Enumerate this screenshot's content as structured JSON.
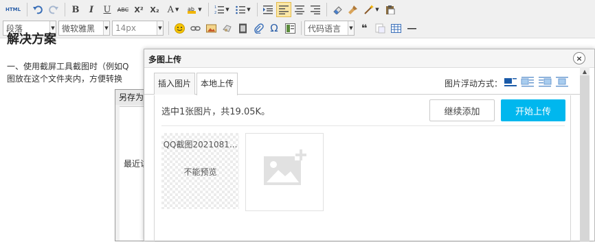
{
  "toolbar": {
    "html_label": "HTML",
    "bold": "B",
    "italic": "I",
    "underline": "U",
    "strike": "ABC",
    "superscript": "X²",
    "subscript": "X₂",
    "font_color": "A",
    "paragraph_select": "段落",
    "font_select": "微软雅黑",
    "size_select": "14px",
    "code_lang_select": "代码语言",
    "quote": "❝",
    "icons": [
      "html-icon",
      "undo-icon",
      "redo-icon",
      "bold-icon",
      "italic-icon",
      "underline-icon",
      "strikethrough-icon",
      "superscript-icon",
      "subscript-icon",
      "font-color-icon",
      "background-color-icon",
      "ordered-list-icon",
      "unordered-list-icon",
      "indent-icon",
      "align-left-icon",
      "align-center-icon",
      "align-right-icon",
      "eraser-icon",
      "format-brush-icon",
      "magic-wand-icon",
      "paste-icon",
      "emoji-icon",
      "link-icon",
      "image-icon",
      "music-icon",
      "video-icon",
      "attachment-icon",
      "omega-icon",
      "template-icon",
      "quote-icon",
      "table-icon",
      "horizontal-rule-icon"
    ]
  },
  "document": {
    "heading": "解决方案",
    "line1": "一、使用截屏工具截图时（例如Q",
    "line2": "图放在这个文件夹内，方便转换"
  },
  "saveas_dialog": {
    "title": "另存为",
    "label_recent": "最近访"
  },
  "upload_dialog": {
    "title": "多图上传",
    "close": "×",
    "tabs": [
      {
        "label": "插入图片",
        "active": false
      },
      {
        "label": "本地上传",
        "active": true
      }
    ],
    "float_label": "图片浮动方式：",
    "status": "选中1张图片，共19.05K。",
    "continue_button": "继续添加",
    "start_button": "开始上传",
    "file": {
      "name": "QQ截图2021081...",
      "preview_text": "不能预览"
    }
  },
  "colors": {
    "accent": "#00b7ee",
    "toolbar_bg": "#f0f0f0",
    "active_button": "#fbe7a6"
  }
}
